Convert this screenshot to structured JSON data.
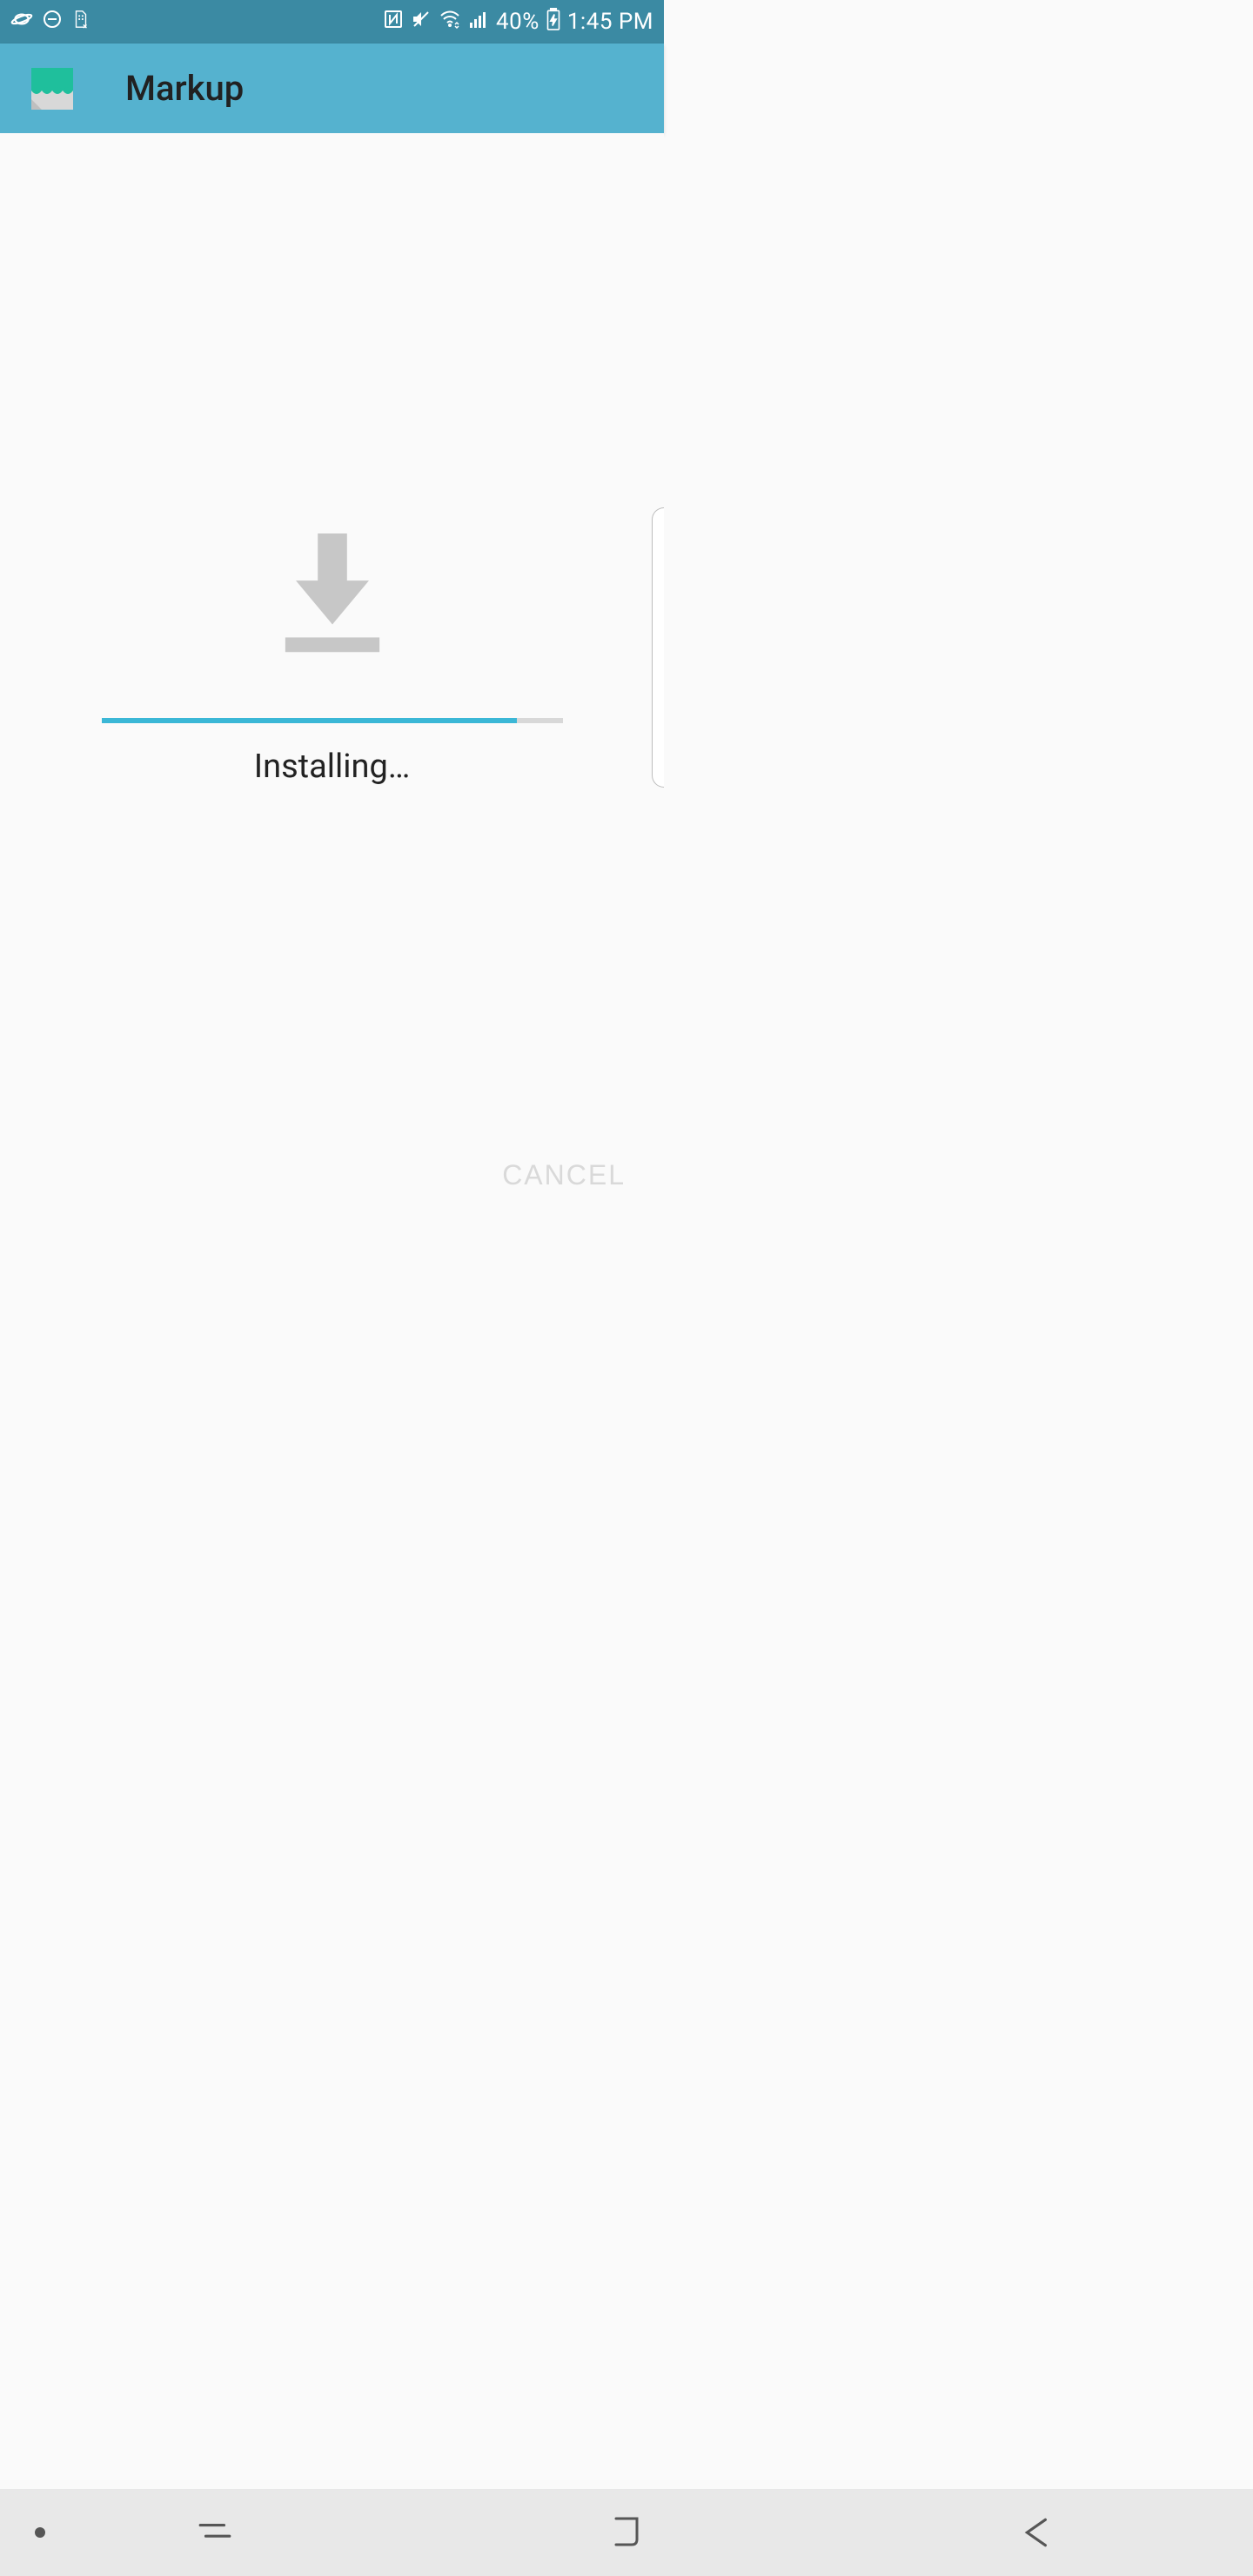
{
  "statusbar": {
    "battery_percent": "40%",
    "time": "1:45 PM"
  },
  "appbar": {
    "title": "Markup"
  },
  "installer": {
    "status": "Installing…",
    "progress_percent": 90,
    "cancel_label": "CANCEL"
  }
}
